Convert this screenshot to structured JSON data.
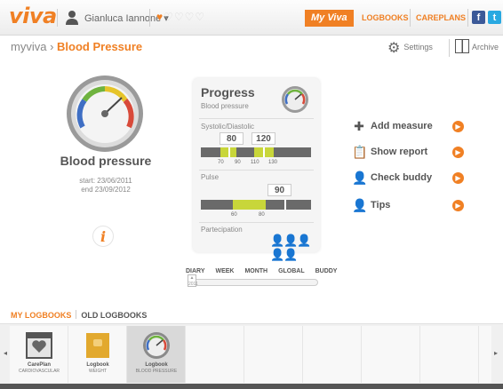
{
  "header": {
    "logo": "viva",
    "user_name": "Gianluca Iannone",
    "user_dropdown": "▾",
    "hearts": {
      "filled": 1,
      "total": 5
    },
    "nav": {
      "myviva": "My Viva",
      "logbooks": "LOGBOOKS",
      "careplans": "CAREPLANS"
    },
    "social": {
      "facebook": "f",
      "twitter": "t"
    },
    "accent_color": "#f08024"
  },
  "breadcrumb": {
    "root": "myviva",
    "separator": "›",
    "current": "Blood Pressure"
  },
  "toolbar": {
    "settings_label": "Settings",
    "archive_label": "Archive"
  },
  "summary": {
    "title": "Blood pressure",
    "start": "start: 23/06/2011",
    "end": "end 23/09/2012",
    "info_label": "i"
  },
  "progress": {
    "title": "Progress",
    "subtitle": "Blood pressure",
    "systolic_label": "Systolic/Diastolic",
    "diastolic_value": "80",
    "systolic_value": "120",
    "sd_ticks": [
      "70",
      "90",
      "110",
      "130"
    ],
    "pulse_label": "Pulse",
    "pulse_value": "90",
    "pulse_ticks": [
      "60",
      "80"
    ],
    "participation_label": "Partecipation"
  },
  "actions": [
    {
      "label": "Add measure",
      "icon": "add-measure-icon"
    },
    {
      "label": "Show report",
      "icon": "clipboard-icon"
    },
    {
      "label": "Check buddy",
      "icon": "buddy-icon"
    },
    {
      "label": "Tips",
      "icon": "tips-icon"
    }
  ],
  "timeline": {
    "tabs": [
      "DIARY",
      "WEEK",
      "MONTH",
      "GLOBAL",
      "BUDDY"
    ],
    "knob_label": "2011"
  },
  "logbooks": {
    "tab_active": "MY LOGBOOKS",
    "tab_other": "OLD LOGBOOKS",
    "items": [
      {
        "name": "CarePlan",
        "category": "CARDIOVASCULAR"
      },
      {
        "name": "Logbook",
        "category": "WEIGHT"
      },
      {
        "name": "Logbook",
        "category": "BLOOD PRESSURE"
      }
    ]
  }
}
